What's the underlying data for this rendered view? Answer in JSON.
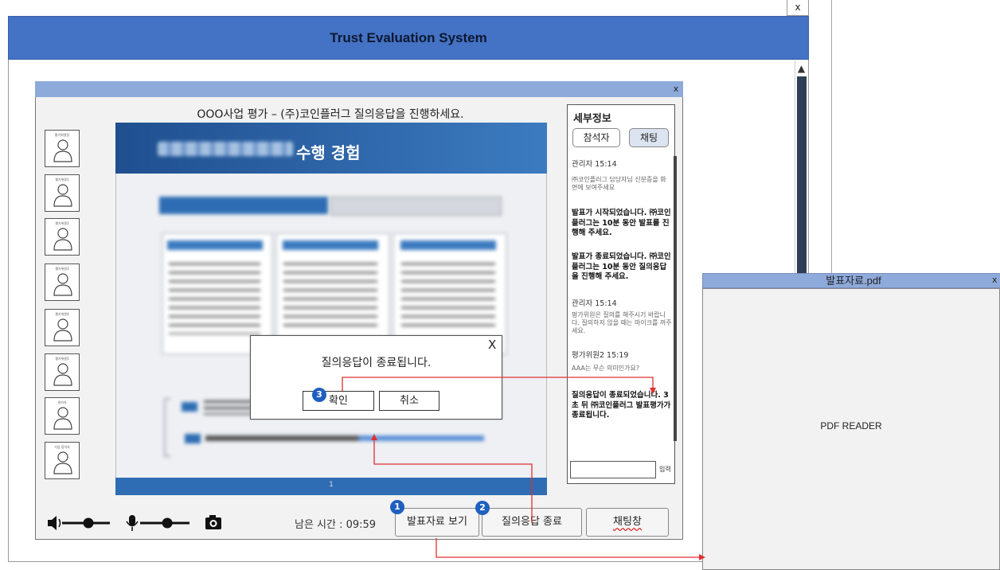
{
  "window": {
    "title": "Trust Evaluation System",
    "close_label": "x"
  },
  "inner_window": {
    "close_label": "x"
  },
  "session_title": "OOO사업 평가 – (주)코인플러그 질의응답을 진행하세요.",
  "slide": {
    "title": "수행 경험",
    "page": "1"
  },
  "participants": [
    "평가위원장",
    "평가위원1",
    "평가위원2",
    "평가위원3",
    "평가위원4",
    "평가위원5",
    "관리자",
    "기업 참석자"
  ],
  "panel": {
    "title": "세부정보",
    "tabs": [
      "참석자",
      "채팅"
    ],
    "messages": [
      {
        "kind": "normal",
        "text": "관리자 15:14"
      },
      {
        "kind": "small",
        "text": "㈜코인플러그 담당자님 신분증을 화면에 보여주세요"
      },
      {
        "kind": "bold",
        "text": "발표가 시작되었습니다. ㈜코인플러그는 10분 동안 발표를 진행해 주세요."
      },
      {
        "kind": "bold",
        "text": "발표가 종료되었습니다. ㈜코인플러그는 10분 동안 질의응답을 진행해 주세요."
      },
      {
        "kind": "normal",
        "text": "관리자 15:14"
      },
      {
        "kind": "small",
        "text": "평가위원은 질의를 해주시기 바랍니다. 질의하지 않을 때는 마이크를 꺼주세요."
      },
      {
        "kind": "normal",
        "text": "평가위원2 15:19"
      },
      {
        "kind": "small",
        "text": "AAA는 무슨 의미인가요?"
      },
      {
        "kind": "bold",
        "text": "질의응답이 종료되었습니다. 3초 뒤 ㈜코인플러그 발표평가가 종료됩니다."
      }
    ],
    "input_value": "",
    "send_label": "입력"
  },
  "controls": {
    "time_label": "남은 시간 : 09:59",
    "view_pdf": "발표자료 보기",
    "end_qa": "질의응답 종료",
    "chat_window": "채팅창",
    "speaker_icon": "speaker-icon",
    "mic_icon": "microphone-icon",
    "camera_icon": "camera-icon",
    "speaker_level": 0.55,
    "mic_level": 0.55
  },
  "dialog": {
    "message": "질의응답이 종료됩니다.",
    "confirm": "확인",
    "cancel": "취소",
    "close_label": "X"
  },
  "badges": [
    "1",
    "2",
    "3"
  ],
  "pdf_window": {
    "title": "발표자료.pdf",
    "close_label": "x",
    "body": "PDF READER"
  },
  "colors": {
    "title_bar": "#4472c4",
    "inner_bar": "#8eaadb",
    "badge": "#1f5fbf",
    "arrow": "#e03030"
  }
}
